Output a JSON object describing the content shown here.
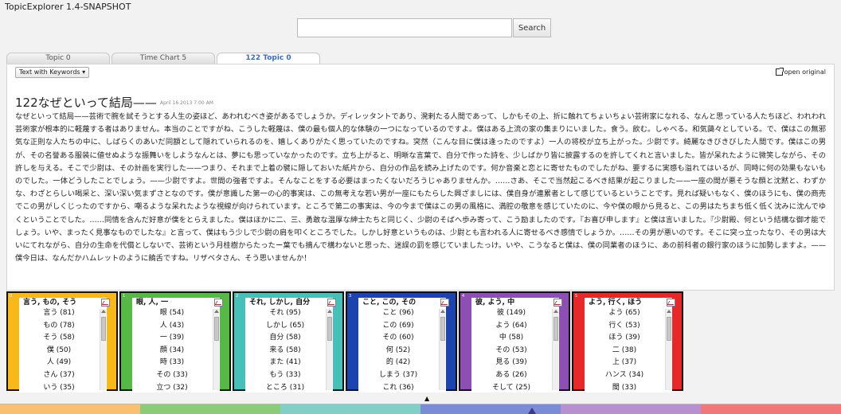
{
  "app": {
    "title": "TopicExplorer 1.4-SNAPSHOT"
  },
  "search": {
    "placeholder": "",
    "value": "",
    "button_label": "Search"
  },
  "tabs": [
    {
      "label": "Topic 0",
      "active": false
    },
    {
      "label": "Time Chart 5",
      "active": false
    },
    {
      "label": "122 Topic 0",
      "active": true
    }
  ],
  "toolbar": {
    "view_mode": "Text with Keywords ▾",
    "open_original": "open original"
  },
  "document": {
    "title": "122なぜといって結局——",
    "date": "April 16 2013 7:00 AM",
    "paragraphs": [
      "なぜといって結局——芸術で腕を試そうとする人生の姿ほど、あわれむべき姿があるでしょうか。ディレッタントであり、溌剌たる人間であって、しかもその上、折に触れてちょいちょい芸術家になれる、なんと思っている人たちほど、われわれ芸術家が根本的に軽蔑する者はありません。本当のことですがね、こうした軽蔑は、僕の最も個人的な体験の一つになっているのですよ。僕はある上流の家の集まりにいました。食う。飲む。しゃべる。和気藹々としている。で、僕はこの無邪気な正則な人たちの中に、しばらくのあいだ同額として隠れていられるのを、嬉しくありがたく思っていたのですね。突然（こんな目に僕は逢ったのですよ）一人の将校が立ち上がった。少尉です。綺麗なきびきびした人間です。僕はこの男が、その名誉ある服装に値せぬような振舞いをしようなんとは、夢にも思っていなかったのです。立ち上がると、明晰な言葉で、自分で作った詩を、少しばかり皆に披露するのを許してくれと言いました。皆が呆れたように微笑しながら、その許しを与える。そこで少尉は、その計画を実行した——つまり、それまで上着の襞に隠しておいた紙片から、自分の作品を読み上げたのです。何か音楽と恋とに寄せたものでしたがね、要するに実感も溢れてはいるが、同時に何の効果もないものでした。一体どうしたことでしょう。——少尉ですよ。世間の強者ですよ。そんなことをする必要はまったくないだろうじゃありませんか。……さあ、そこで当然起こるべき結果が起こりました——一座の間が悪そうな顔と沈黙と、わずかな、わざとらしい喝采と、深い深い気まずさとなのです。僕が意識した第一の心的事実は、この無考えな若い男が一座にもたらした興ざましには、僕自身が連累者として感じているということです。見れば疑いもなく、僕のほうにも、僕の商売でこの男がしくじったのですから、嘲るような呆れたような視線が向けられています。ところで第二の事実は、今の今まで僕はこの男の風格に、満腔の敬意を感じていたのに、今や僕の眼から見ると、この男はたちまち低く低く沈みに沈んでゆくということでした。……同情を含んだ好意が僕をとらえました。僕はほかに二、三、勇敢な温厚な紳士たちと同じく、少尉のそばへ歩み寄って、こう励ましたのです。『お喜び申します』と僕は言いました。『少尉殿、何という結構な御才能でしょう。いや、まったく見事なものでしたな』と言って、僕はもう少しで少尉の肩を叩くところでした。しかし好意というものは、少尉とも言われる人に寄せるべき感情でしょうか。……その男が悪いのです。そこに突っ立ったなり、その男は大いにてれながら、自分の生命を代償としないで、芸術という月桂樹からたったー葉でも摘んで構わないと思った、迷誤の罰を感じていましたっけ。いや、こうなると僕は、僕の同業者のほうに、あの前科者の銀行家のほうに加勢しますよ。——僕今日は、なんだかハムレットのように饒舌ですね。リザベタさん、そう思いませんか！"
    ]
  },
  "topics": [
    {
      "id": "0",
      "title": "言う, もの, そう",
      "color": "#f8b818",
      "words": [
        "言う (81)",
        "もの (78)",
        "そう (58)",
        "僕 (50)",
        "人 (49)",
        "さん (37)",
        "いう (35)"
      ]
    },
    {
      "id": "1",
      "title": "眼, 人, 一",
      "color": "#56b845",
      "words": [
        "眼 (54)",
        "人 (43)",
        "一 (39)",
        "顔 (34)",
        "時 (33)",
        "その (33)",
        "立つ (32)"
      ]
    },
    {
      "id": "2",
      "title": "それ, しかし, 自分",
      "color": "#46c0b8",
      "words": [
        "それ (95)",
        "しかし (65)",
        "自分 (58)",
        "来る (58)",
        "また (41)",
        "もう (33)",
        "ところ (31)"
      ]
    },
    {
      "id": "3",
      "title": "こと, この, その",
      "color": "#1c44b0",
      "words": [
        "こと (96)",
        "この (69)",
        "その (60)",
        "何 (52)",
        "的 (42)",
        "しまう (37)",
        "これ (36)"
      ]
    },
    {
      "id": "4",
      "title": "彼, よう, 中",
      "color": "#8e4fb4",
      "words": [
        "彼 (149)",
        "よう (64)",
        "中 (58)",
        "その (53)",
        "見る (39)",
        "ある (26)",
        "そして (25)"
      ]
    },
    {
      "id": "5",
      "title": "よう, 行く, ほう",
      "color": "#e82828",
      "words": [
        "よう (65)",
        "行く (53)",
        "ほう (39)",
        "二 (38)",
        "上 (37)",
        "ハンス (34)",
        "間 (33)"
      ]
    }
  ],
  "colorbar": [
    "#f8c070",
    "#8ccc78",
    "#80d0c8",
    "#7a8cd8",
    "#b890d0",
    "#f07878"
  ],
  "icons": {
    "open_original": "external-link-icon",
    "topic_chart": "line-chart-icon",
    "pager": "triangle-up-icon"
  }
}
